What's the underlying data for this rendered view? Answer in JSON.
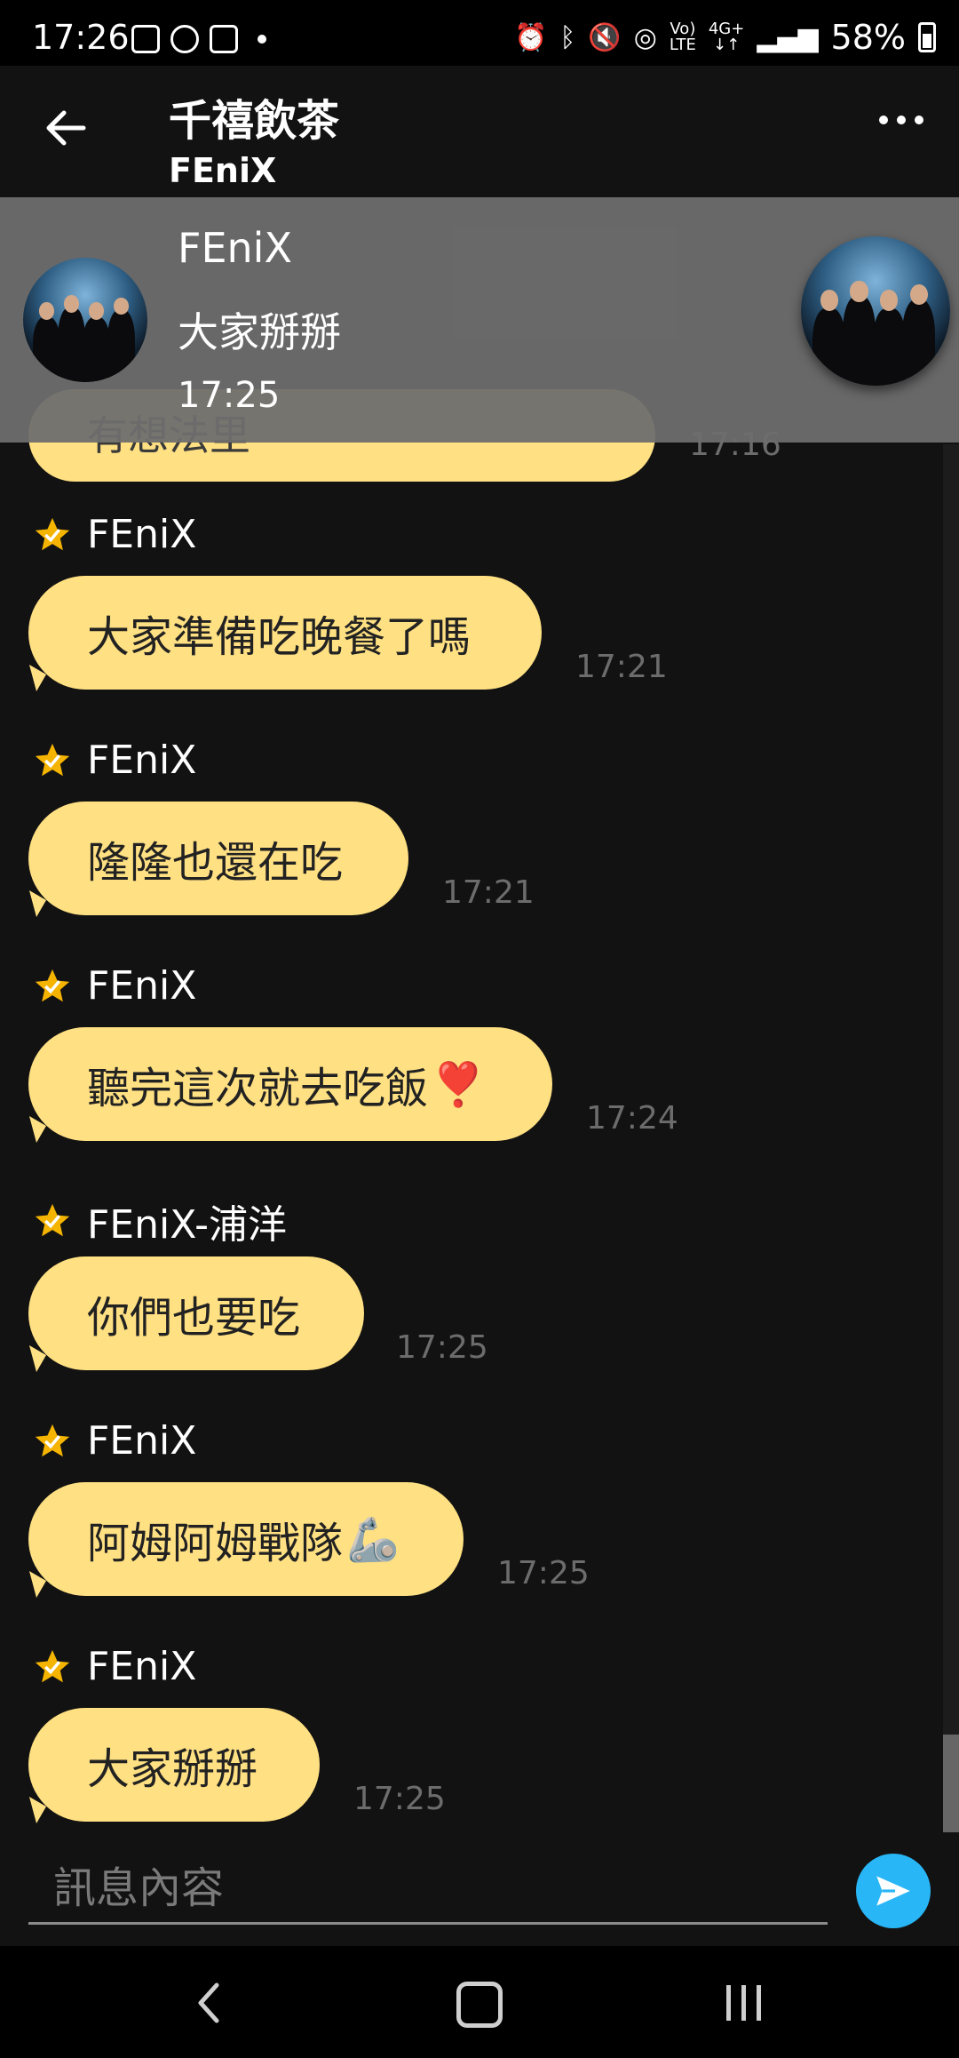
{
  "status_bar": {
    "time": "17:26",
    "battery": "58%",
    "net_top": "Vo)",
    "net_bottom": "LTE",
    "net2_top": "4G+",
    "net2_bottom": "↓↑"
  },
  "header": {
    "title": "千禧飲茶",
    "subtitle": "FEniX"
  },
  "partial_message": {
    "text": "有想法里",
    "time": "17:16"
  },
  "messages": [
    {
      "sender": "FEniX",
      "text": "大家準備吃晚餐了嗎",
      "time": "17:21"
    },
    {
      "sender": "FEniX",
      "text": "隆隆也還在吃",
      "time": "17:21"
    },
    {
      "sender": "FEniX",
      "text": "聽完這次就去吃飯",
      "emoji": "❣️",
      "time": "17:24"
    },
    {
      "sender": "FEniX-浦洋",
      "text": "你們也要吃",
      "time": "17:25"
    },
    {
      "sender": "FEniX",
      "text": "阿姆阿姆戰隊",
      "emoji": "🦾",
      "time": "17:25"
    },
    {
      "sender": "FEniX",
      "text": "大家掰掰",
      "time": "17:25"
    }
  ],
  "notification": {
    "sender": "FEniX",
    "message": "大家掰掰",
    "time": "17:25"
  },
  "composer": {
    "placeholder": "訊息內容"
  },
  "colors": {
    "bubble": "#FFE082",
    "background": "#121212",
    "send_button": "#29b6f6",
    "star": "#F5B400"
  }
}
